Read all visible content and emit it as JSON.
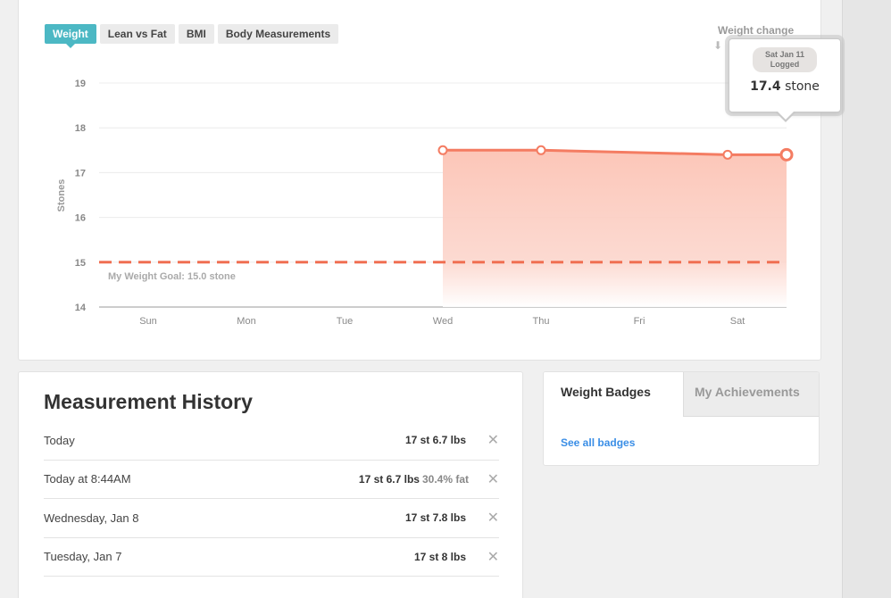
{
  "chart_tabs": [
    {
      "label": "Weight",
      "active": true
    },
    {
      "label": "Lean vs Fat",
      "active": false
    },
    {
      "label": "BMI",
      "active": false
    },
    {
      "label": "Body Measurements",
      "active": false
    }
  ],
  "weight_change": {
    "label": "Weight change",
    "arrow_icon": "down-arrow-icon"
  },
  "tooltip": {
    "date_badge_line1": "Sat Jan 11",
    "date_badge_line2": "Logged",
    "value": "17.4",
    "unit": "stone"
  },
  "chart_data": {
    "type": "area",
    "ylabel": "Stones",
    "xlabel": "",
    "categories": [
      "Sun",
      "Mon",
      "Tue",
      "Wed",
      "Thu",
      "Fri",
      "Sat"
    ],
    "ylim": [
      14,
      19
    ],
    "yticks": [
      14,
      15,
      16,
      17,
      18,
      19
    ],
    "grid": true,
    "series": [
      {
        "x": [
          3.5,
          4.5,
          6.4,
          7.0
        ],
        "y": [
          17.5,
          17.5,
          17.4,
          17.4
        ],
        "color": "#f47c62",
        "fill": "#fcd3c9"
      }
    ],
    "goal": {
      "value": 15.0,
      "label": "My Weight Goal: 15.0 stone",
      "color": "#f06f52"
    }
  },
  "history": {
    "title": "Measurement History",
    "rows": [
      {
        "date": "Today",
        "value": "17 st 6.7 lbs",
        "fat": ""
      },
      {
        "date": "Today at 8:44AM",
        "value": "17 st 6.7 lbs",
        "fat": "30.4% fat"
      },
      {
        "date": "Wednesday, Jan 8",
        "value": "17 st 7.8 lbs",
        "fat": ""
      },
      {
        "date": "Tuesday, Jan 7",
        "value": "17 st 8 lbs",
        "fat": ""
      }
    ],
    "delete_icon": "close-icon",
    "delete_glyph": "✕"
  },
  "badges": {
    "tab_active": "Weight Badges",
    "tab_inactive": "My Achievements",
    "link": "See all badges"
  },
  "colors": {
    "accent": "#4cb8c4",
    "line": "#f47c62",
    "area": "#fcd3c9",
    "link": "#3a8ee6"
  }
}
